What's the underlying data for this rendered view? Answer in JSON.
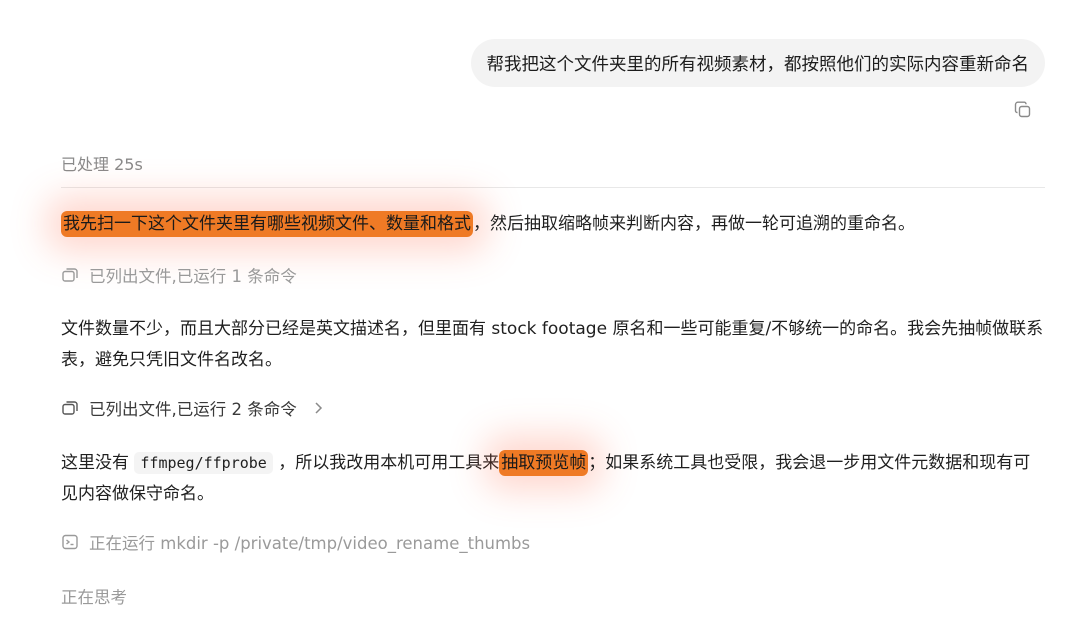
{
  "user_message": "帮我把这个文件夹里的所有视频素材，都按照他们的实际内容重新命名",
  "status": {
    "processed_label": "已处理 25s"
  },
  "paragraphs": {
    "p1": {
      "highlight": "我先扫一下这个文件夹里有哪些视频文件、数量和格式",
      "rest": "，然后抽取缩略帧来判断内容，再做一轮可追溯的重命名。"
    },
    "p2": "文件数量不少，而且大部分已经是英文描述名，但里面有 stock footage 原名和一些可能重复/不够统一的命名。我会先抽帧做联系表，避免只凭旧文件名改名。",
    "p3": {
      "before": "这里没有 ",
      "code": "ffmpeg/ffprobe",
      "middle": " ，所以我改用本机可用工具来",
      "highlight": "抽取预览帧",
      "after": "；如果系统工具也受限，我会退一步用文件元数据和现有可见内容做保守命名。"
    }
  },
  "steps": {
    "s1": "已列出文件,已运行 1 条命令",
    "s2": "已列出文件,已运行 2 条命令",
    "s3": "正在运行 mkdir -p /private/tmp/video_rename_thumbs"
  },
  "thinking_label": "正在思考",
  "icons": {
    "copy": "copy-icon",
    "files": "files-icon",
    "chevron": "chevron-right-icon",
    "terminal": "terminal-icon"
  },
  "colors": {
    "highlight": "#ef7a25",
    "bubble_bg": "#f3f3f3",
    "muted_text": "#9a9a9a"
  }
}
